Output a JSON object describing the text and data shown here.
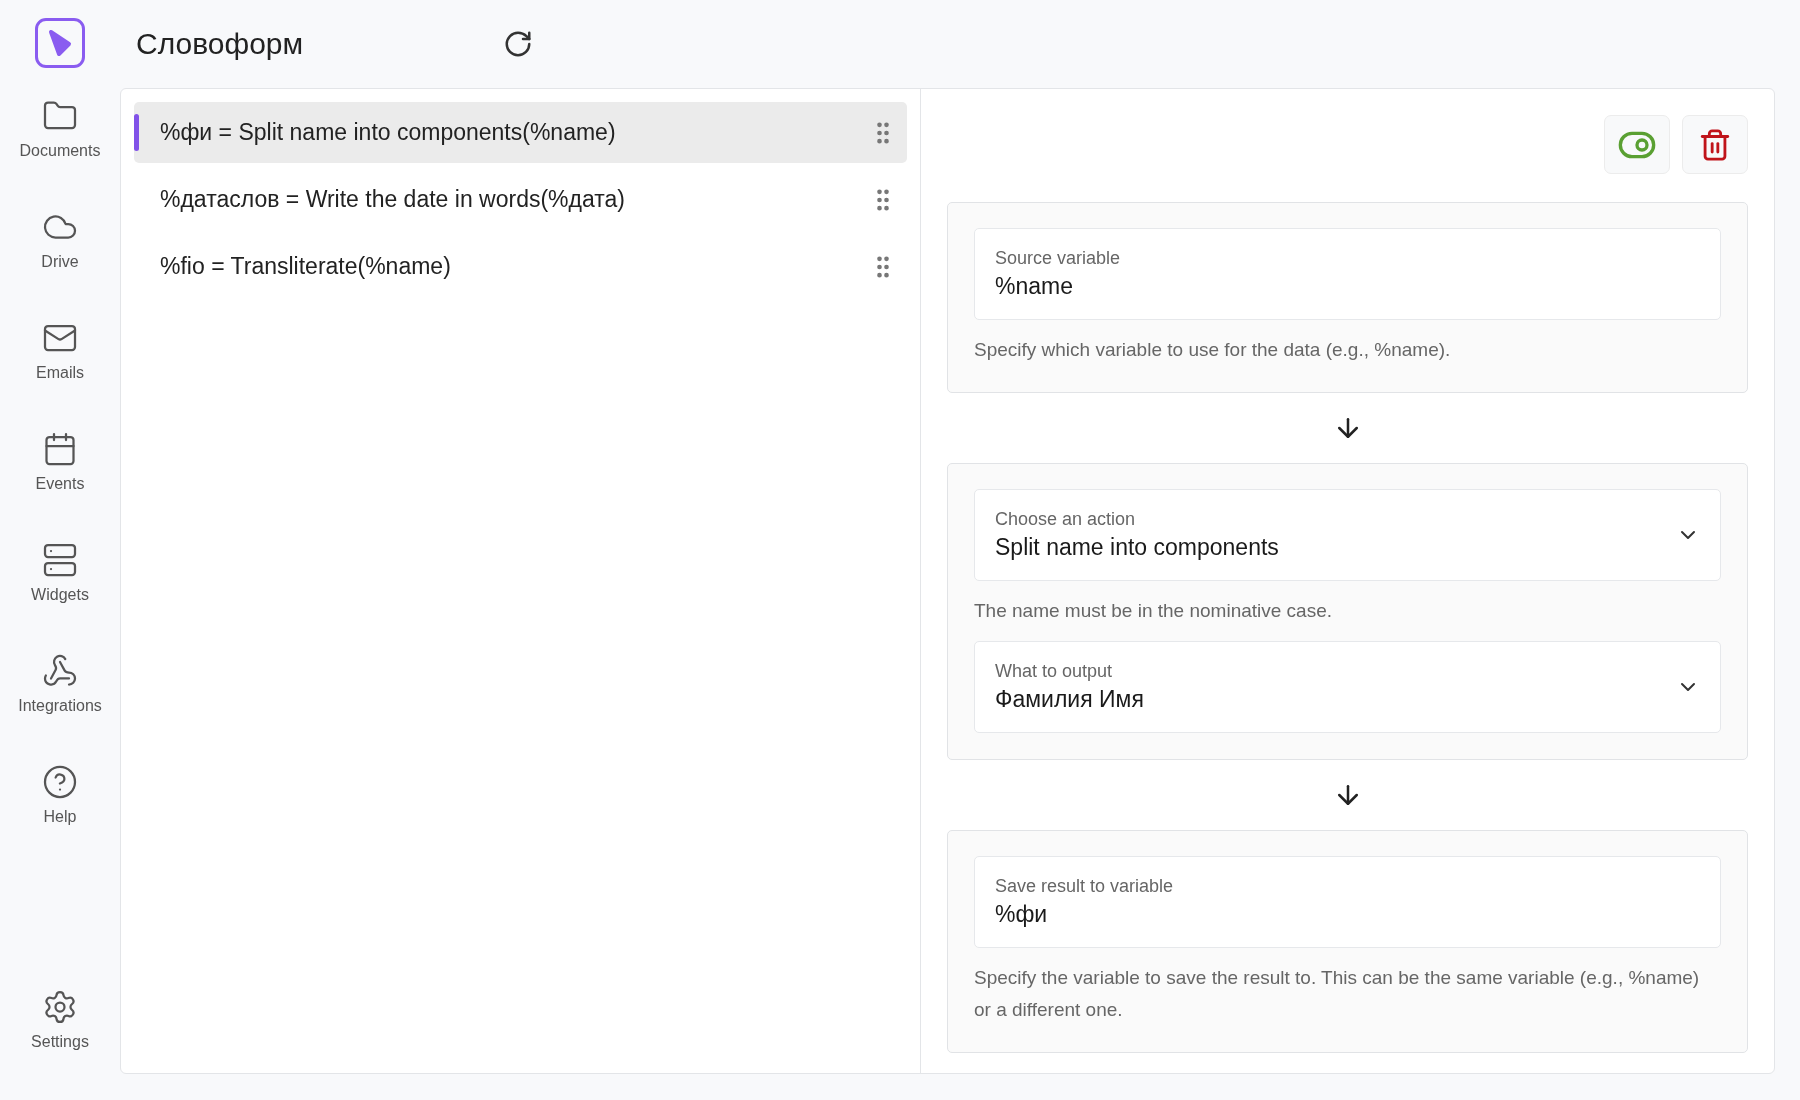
{
  "app": {
    "title": "Словоформ"
  },
  "sidebar": {
    "items": [
      {
        "kind": "documents",
        "label": "Documents"
      },
      {
        "kind": "drive",
        "label": "Drive"
      },
      {
        "kind": "emails",
        "label": "Emails"
      },
      {
        "kind": "events",
        "label": "Events"
      },
      {
        "kind": "widgets",
        "label": "Widgets"
      },
      {
        "kind": "integrations",
        "label": "Integrations"
      },
      {
        "kind": "help",
        "label": "Help"
      }
    ],
    "settings": {
      "label": "Settings"
    }
  },
  "rules": [
    {
      "text": "%фи = Split name into components(%name)",
      "selected": true
    },
    {
      "text": "%датаслов = Write the date in words(%дата)",
      "selected": false
    },
    {
      "text": "%fio = Transliterate(%name)",
      "selected": false
    }
  ],
  "editor": {
    "enabled": true,
    "source": {
      "label": "Source variable",
      "value": "%name",
      "hint": "Specify which variable to use for the data (e.g., %name)."
    },
    "action": {
      "label": "Choose an action",
      "value": "Split name into components",
      "hint": "The name must be in the nominative case."
    },
    "output": {
      "label": "What to output",
      "value": "Фамилия Имя"
    },
    "result": {
      "label": "Save result to variable",
      "value": "%фи",
      "hint": "Specify the variable to save the result to. This can be the same variable (e.g., %name) or a different one."
    }
  }
}
